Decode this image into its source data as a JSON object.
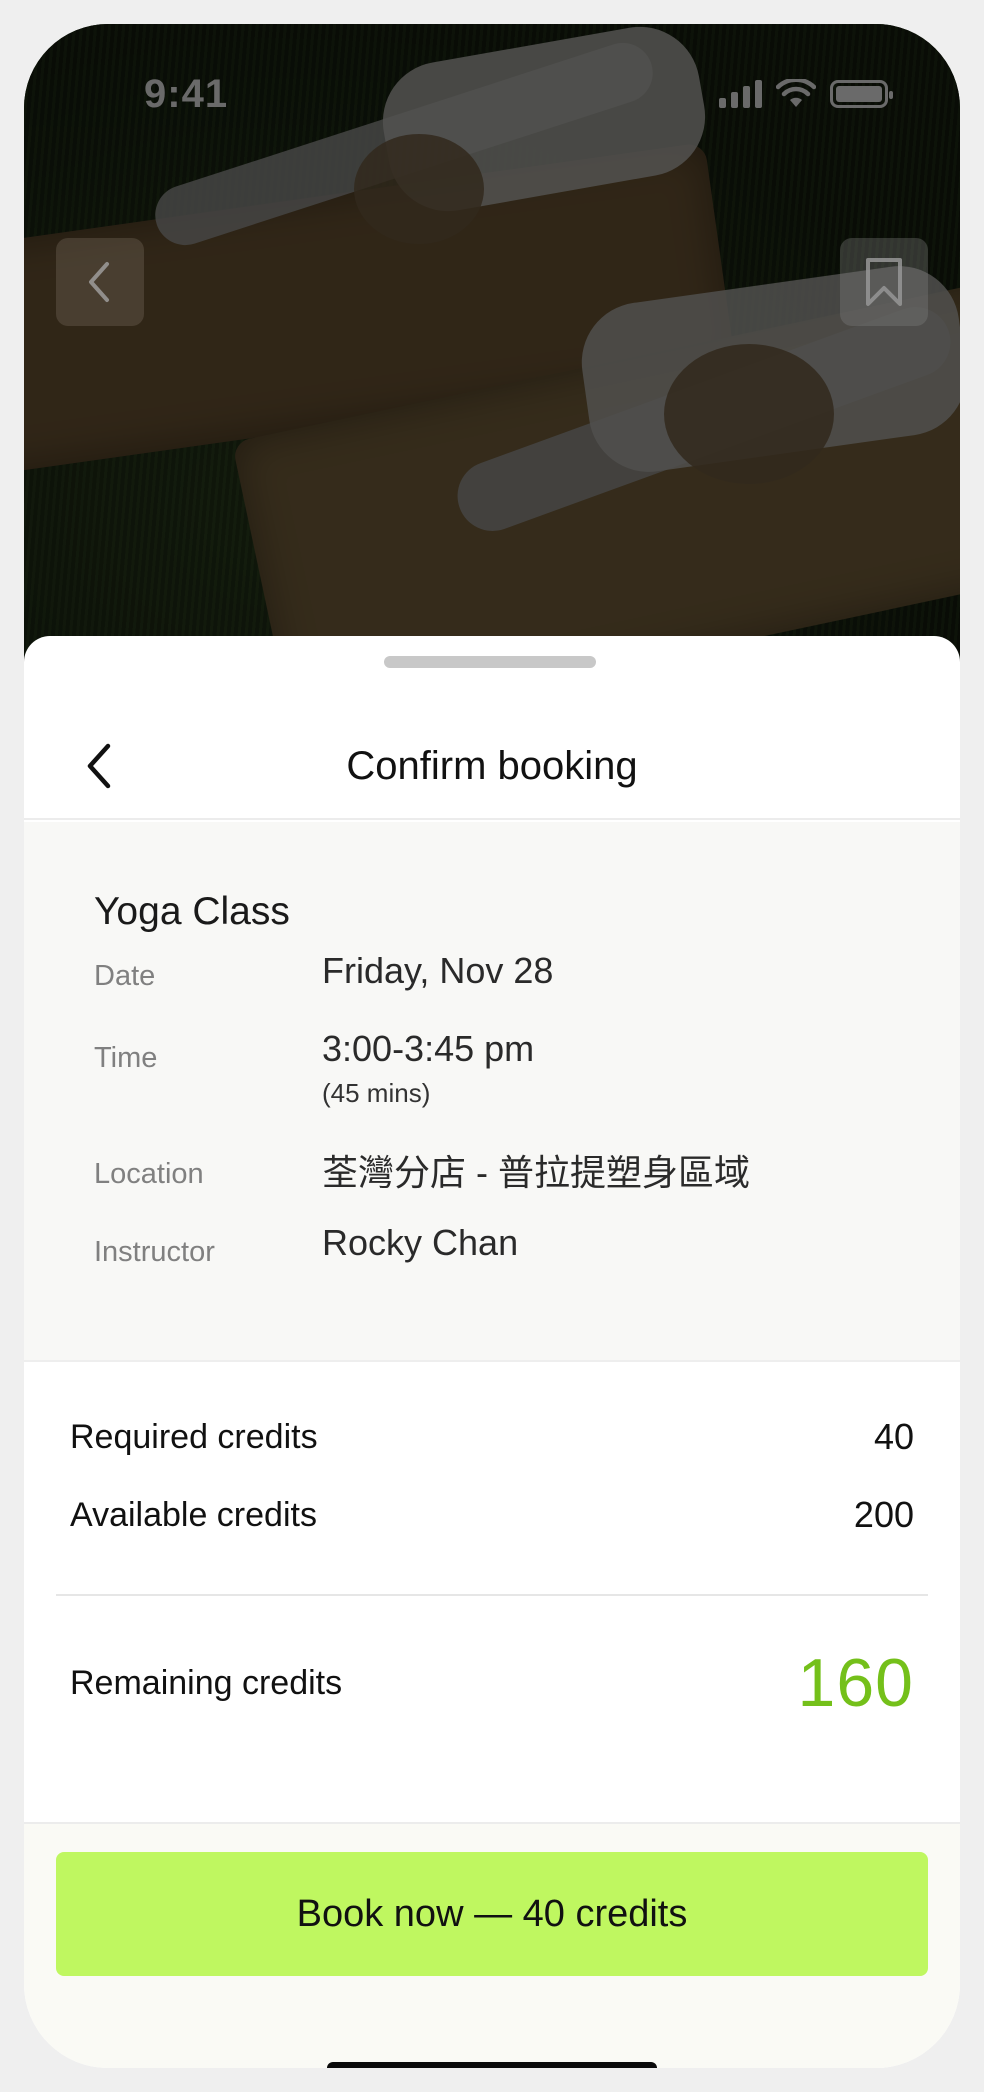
{
  "status_bar": {
    "time": "9:41"
  },
  "sheet": {
    "title": "Confirm booking"
  },
  "booking": {
    "class_name": "Yoga Class",
    "rows": [
      {
        "label": "Date",
        "value": "Friday, Nov 28"
      },
      {
        "label": "Time",
        "value": "3:00-3:45 pm",
        "sub": "(45 mins)"
      },
      {
        "label": "Location",
        "value": "荃灣分店 - 普拉提塑身區域"
      },
      {
        "label": "Instructor",
        "value": "Rocky Chan"
      }
    ]
  },
  "credits": {
    "required_label": "Required credits",
    "required_value": "40",
    "available_label": "Available credits",
    "available_value": "200",
    "remaining_label": "Remaining credits",
    "remaining_value": "160"
  },
  "cta": {
    "label": "Book now — 40 credits"
  },
  "colors": {
    "accent": "#bff760",
    "remaining": "#74c01a"
  },
  "icons": {
    "hero_back": "chevron-left-icon",
    "hero_bookmark": "bookmark-icon",
    "sheet_back": "chevron-left-icon"
  }
}
